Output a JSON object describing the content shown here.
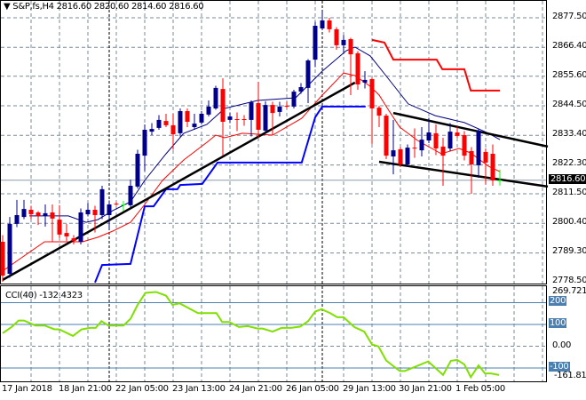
{
  "header": {
    "symbol": "S&P,fs,H4",
    "open": "2816.60",
    "high": "2820.60",
    "low": "2814.60",
    "close": "2816.60"
  },
  "price_axis": [
    "2877.50",
    "2866.40",
    "2855.60",
    "2844.50",
    "2833.40",
    "2822.30",
    "2811.50",
    "2800.40",
    "2789.30",
    "2778.50"
  ],
  "current_price": "2816.60",
  "cci": {
    "title": "CCI(40) -132.4323",
    "max_label": "269.7219",
    "min_label": "-161.8116",
    "levels": [
      "200",
      "100",
      "0.00",
      "-100"
    ]
  },
  "time_axis": [
    "17 Jan 2018",
    "18 Jan 21:00",
    "22 Jan 05:00",
    "23 Jan 13:00",
    "24 Jan 21:00",
    "26 Jan 05:00",
    "29 Jan 13:00",
    "30 Jan 21:00",
    "1 Feb 05:00"
  ],
  "colors": {
    "bull": "#00008b",
    "bear": "#ff0000",
    "doji": "#00ff00",
    "ma_fast": "#000080",
    "ma_slow": "#ff0000",
    "kijun": "#0000ff",
    "resist": "#ff0000",
    "trend": "#000000",
    "cci": "#80e000",
    "grid": "#7a8a99",
    "level": "#4a7fb0"
  },
  "chart_data": {
    "type": "candlestick",
    "title": "S&P,fs,H4",
    "ylim": [
      2778.5,
      2877.5
    ],
    "candles": [
      [
        2793.5,
        2796,
        2778.5,
        2780.8
      ],
      [
        2781.5,
        2802.8,
        2780,
        2800.2
      ],
      [
        2800.2,
        2809.2,
        2799,
        2803.5
      ],
      [
        2802.8,
        2809.2,
        2802,
        2805.8
      ],
      [
        2805.5,
        2807,
        2802,
        2803.8
      ],
      [
        2804.5,
        2805,
        2799.8,
        2803.2
      ],
      [
        2803.2,
        2807.5,
        2799.2,
        2804.2
      ],
      [
        2804.5,
        2807.5,
        2793.5,
        2802.2
      ],
      [
        2801.8,
        2807.2,
        2795,
        2796.2
      ],
      [
        2796.8,
        2800.2,
        2793.8,
        2795.5
      ],
      [
        2794.8,
        2796,
        2792.5,
        2793.8
      ],
      [
        2793.5,
        2806,
        2792.5,
        2804.5
      ],
      [
        2803.8,
        2808,
        2803,
        2805.5
      ],
      [
        2805.5,
        2807,
        2797,
        2803.5
      ],
      [
        2803.5,
        2814.5,
        2802,
        2813.2
      ],
      [
        2803.5,
        2809,
        2798,
        2807.5
      ],
      [
        2807.8,
        2808.5,
        2807,
        2807.5
      ],
      [
        2807.5,
        2808.8,
        2805,
        2807.5
      ],
      [
        2807.2,
        2816.8,
        2806.5,
        2814.5
      ],
      [
        2814.2,
        2828,
        2813.5,
        2826.5
      ],
      [
        2825.8,
        2837.5,
        2820,
        2835.5
      ],
      [
        2834.8,
        2838,
        2833.5,
        2835.8
      ],
      [
        2836.2,
        2841,
        2835.5,
        2839.2
      ],
      [
        2838.8,
        2841.5,
        2836.5,
        2837.2
      ],
      [
        2837.2,
        2841.5,
        2828,
        2833.8
      ],
      [
        2834.2,
        2843.5,
        2833,
        2842.5
      ],
      [
        2842.5,
        2843.5,
        2836.5,
        2838.5
      ],
      [
        2836.5,
        2841.5,
        2835.5,
        2837.8
      ],
      [
        2838.2,
        2842.5,
        2837.5,
        2841.5
      ],
      [
        2841.2,
        2846.5,
        2840.5,
        2844.2
      ],
      [
        2843.5,
        2852,
        2843,
        2851.2
      ],
      [
        2850.8,
        2854.8,
        2825.8,
        2838.5
      ],
      [
        2839.2,
        2842,
        2838,
        2840.5
      ],
      [
        2839.5,
        2842,
        2835,
        2839.2
      ],
      [
        2839.5,
        2841,
        2837,
        2839.2
      ],
      [
        2839.2,
        2846.5,
        2833,
        2845.8
      ],
      [
        2845.5,
        2853.5,
        2832.5,
        2835.5
      ],
      [
        2835.2,
        2846.2,
        2834.5,
        2844.8
      ],
      [
        2844.8,
        2846,
        2833.5,
        2841.8
      ],
      [
        2842.2,
        2846,
        2840.5,
        2844.2
      ],
      [
        2844.5,
        2846,
        2843.5,
        2844.2
      ],
      [
        2844.2,
        2850.5,
        2843.5,
        2849.8
      ],
      [
        2849.8,
        2853,
        2849,
        2851.5
      ],
      [
        2851.2,
        2862,
        2845.5,
        2861.5
      ],
      [
        2861.8,
        2876,
        2859,
        2874.5
      ],
      [
        2873.5,
        2880,
        2873,
        2876.5
      ],
      [
        2876.5,
        2877.5,
        2872,
        2873.2
      ],
      [
        2873.2,
        2874,
        2865.5,
        2867.2
      ],
      [
        2867.2,
        2871,
        2864,
        2869.2
      ],
      [
        2869.5,
        2870,
        2848.5,
        2863.8
      ],
      [
        2864.2,
        2865,
        2850.5,
        2852.5
      ],
      [
        2853.2,
        2857.5,
        2851,
        2854.2
      ],
      [
        2854.5,
        2855,
        2830.2,
        2843.5
      ],
      [
        2843.8,
        2844.5,
        2836.5,
        2840.8
      ],
      [
        2840.8,
        2841.5,
        2824.5,
        2825.8
      ],
      [
        2825.5,
        2839.2,
        2818.8,
        2827.8
      ],
      [
        2828.2,
        2829,
        2821.5,
        2822.5
      ],
      [
        2822.5,
        2830,
        2821.5,
        2828.8
      ],
      [
        2828.8,
        2836,
        2825,
        2828.5
      ],
      [
        2827.8,
        2836.5,
        2825.5,
        2831.8
      ],
      [
        2831.5,
        2840,
        2830.5,
        2834.5
      ],
      [
        2834.2,
        2837.5,
        2826,
        2828.5
      ],
      [
        2829.2,
        2832.5,
        2814.5,
        2825.8
      ],
      [
        2828.5,
        2838,
        2827.5,
        2834.8
      ],
      [
        2834.5,
        2836.8,
        2832.5,
        2833.2
      ],
      [
        2833.5,
        2835,
        2824,
        2825.8
      ],
      [
        2827.5,
        2829,
        2811.5,
        2822.5
      ],
      [
        2822.2,
        2836,
        2817.5,
        2835.2
      ],
      [
        2827.2,
        2828.5,
        2815,
        2823.2
      ],
      [
        2826.5,
        2830,
        2814.5,
        2816.5
      ],
      [
        2816.6,
        2820.6,
        2814.6,
        2816.6
      ]
    ],
    "ma_fast": [
      [
        4.75,
        2803.2
      ],
      [
        10.25,
        2803.2
      ],
      [
        12.75,
        2800.8
      ],
      [
        14.4,
        2801.8
      ],
      [
        16.5,
        2805.2
      ],
      [
        19,
        2808.5
      ],
      [
        21,
        2816.5
      ],
      [
        24,
        2826.5
      ],
      [
        26.5,
        2834.2
      ],
      [
        29.75,
        2837.5
      ],
      [
        32.25,
        2843.5
      ],
      [
        36.9,
        2846.5
      ],
      [
        42.25,
        2847.5
      ],
      [
        46,
        2857.5
      ],
      [
        49.4,
        2865.2
      ],
      [
        50.6,
        2866.5
      ],
      [
        52.75,
        2863.2
      ],
      [
        54.75,
        2856.5
      ],
      [
        58.1,
        2845.2
      ],
      [
        61.9,
        2840.8
      ],
      [
        66,
        2838.2
      ],
      [
        69.4,
        2834.2
      ],
      [
        71,
        2831.8
      ]
    ],
    "ma_slow": [
      [
        1,
        2782.5
      ],
      [
        3.1,
        2786.5
      ],
      [
        6.9,
        2793.5
      ],
      [
        12.25,
        2793.5
      ],
      [
        14.4,
        2795.2
      ],
      [
        16.5,
        2797.5
      ],
      [
        19,
        2800.8
      ],
      [
        21,
        2807.5
      ],
      [
        23.5,
        2816.5
      ],
      [
        26.5,
        2824.2
      ],
      [
        29.75,
        2830.8
      ],
      [
        31,
        2833.5
      ],
      [
        32.25,
        2832.5
      ],
      [
        34.75,
        2834.2
      ],
      [
        39,
        2833.5
      ],
      [
        43.1,
        2839.8
      ],
      [
        46,
        2848.5
      ],
      [
        49,
        2856.8
      ],
      [
        50.6,
        2855.8
      ],
      [
        52.75,
        2851.8
      ],
      [
        54,
        2848.5
      ],
      [
        55.25,
        2843.2
      ],
      [
        56.9,
        2836.5
      ],
      [
        59.4,
        2831.5
      ],
      [
        62.75,
        2826.5
      ],
      [
        65.25,
        2828.5
      ],
      [
        66.9,
        2826.8
      ],
      [
        69.4,
        2821.8
      ],
      [
        71,
        2819.8
      ]
    ],
    "support_step": [
      [
        14,
        2778.2
      ],
      [
        15,
        2784.8
      ],
      [
        19,
        2785.2
      ],
      [
        21,
        2806.8
      ],
      [
        22.25,
        2806.8
      ],
      [
        24,
        2813.2
      ],
      [
        25.6,
        2813.2
      ],
      [
        26,
        2814.8
      ],
      [
        29.1,
        2815.2
      ],
      [
        31.25,
        2823.2
      ],
      [
        43.1,
        2823.2
      ],
      [
        45,
        2840.2
      ],
      [
        46,
        2844.2
      ],
      [
        52.1,
        2844.2
      ]
    ],
    "resistance_step": [
      [
        53,
        2869.2
      ],
      [
        54.75,
        2868.2
      ],
      [
        56,
        2861.8
      ],
      [
        62.1,
        2861.8
      ],
      [
        62.9,
        2858.2
      ],
      [
        66,
        2858.2
      ],
      [
        66.9,
        2850.2
      ],
      [
        71,
        2850.2
      ]
    ],
    "trendlines": [
      [
        [
          1,
          2779.2
        ],
        [
          50.6,
          2853.2
        ]
      ],
      [
        [
          56,
          2841.8
        ],
        [
          77.75,
          2829.2
        ]
      ],
      [
        [
          54,
          2823.5
        ],
        [
          77.75,
          2814.2
        ]
      ]
    ],
    "cci": {
      "ylim": [
        -161.8116,
        269.7219
      ],
      "points": [
        [
          1,
          60
        ],
        [
          2.25,
          88
        ],
        [
          3.25,
          118
        ],
        [
          4,
          118
        ],
        [
          5.6,
          95
        ],
        [
          6.9,
          95
        ],
        [
          8.25,
          78
        ],
        [
          9,
          77
        ],
        [
          10.9,
          47
        ],
        [
          12.1,
          77
        ],
        [
          13.25,
          84
        ],
        [
          14.1,
          84
        ],
        [
          14.9,
          115
        ],
        [
          15.9,
          95
        ],
        [
          18,
          95
        ],
        [
          19,
          126
        ],
        [
          20,
          190
        ],
        [
          21.1,
          245
        ],
        [
          22.6,
          249
        ],
        [
          24,
          232
        ],
        [
          24.9,
          190
        ],
        [
          25.9,
          197
        ],
        [
          28.5,
          152
        ],
        [
          31.1,
          152
        ],
        [
          31.9,
          111
        ],
        [
          32.9,
          111
        ],
        [
          34.25,
          88
        ],
        [
          35.5,
          92
        ],
        [
          36.9,
          81
        ],
        [
          37.6,
          81
        ],
        [
          39,
          67
        ],
        [
          40.25,
          84
        ],
        [
          41.6,
          84
        ],
        [
          42.9,
          90
        ],
        [
          44,
          115
        ],
        [
          45,
          159
        ],
        [
          45.9,
          170
        ],
        [
          47.1,
          152
        ],
        [
          48.1,
          133
        ],
        [
          49,
          133
        ],
        [
          50.5,
          88
        ],
        [
          51.9,
          67
        ],
        [
          53,
          8
        ],
        [
          53.9,
          -1
        ],
        [
          55,
          -66
        ],
        [
          56.9,
          -114
        ],
        [
          57.6,
          -114
        ],
        [
          58.9,
          -97
        ],
        [
          60.9,
          -70
        ],
        [
          63,
          -132
        ],
        [
          64.1,
          -67
        ],
        [
          65,
          -63
        ],
        [
          66,
          -84
        ],
        [
          66.9,
          -142
        ],
        [
          68,
          -88
        ],
        [
          68.9,
          -125
        ],
        [
          69.75,
          -125
        ],
        [
          70.9,
          -132.4
        ]
      ]
    }
  }
}
